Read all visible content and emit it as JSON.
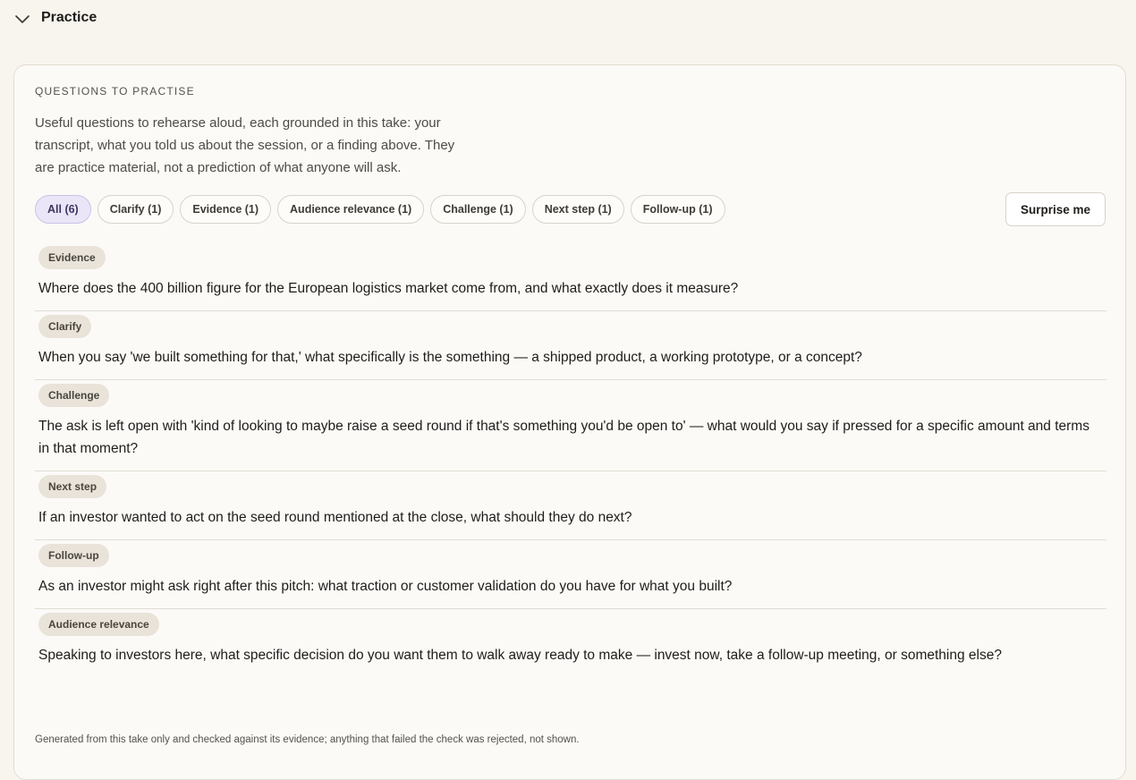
{
  "section": {
    "title": "Practice",
    "icon": "chevron-down-icon"
  },
  "card": {
    "eyebrow": "QUESTIONS TO PRACTISE",
    "intro": "Useful questions to rehearse aloud, each grounded in this take: your transcript, what you told us about the session, or a finding above. They are practice material, not a prediction of what anyone will ask.",
    "surprise_label": "Surprise me",
    "footnote": "Generated from this take only and checked against its evidence; anything that failed the check was rejected, not shown."
  },
  "filters": [
    {
      "label": "All (6)",
      "active": true
    },
    {
      "label": "Clarify (1)",
      "active": false
    },
    {
      "label": "Evidence (1)",
      "active": false
    },
    {
      "label": "Audience relevance (1)",
      "active": false
    },
    {
      "label": "Challenge (1)",
      "active": false
    },
    {
      "label": "Next step (1)",
      "active": false
    },
    {
      "label": "Follow-up (1)",
      "active": false
    }
  ],
  "questions": [
    {
      "tag": "Evidence",
      "text": "Where does the 400 billion figure for the European logistics market come from, and what exactly does it measure?"
    },
    {
      "tag": "Clarify",
      "text": "When you say 'we built something for that,' what specifically is the something — a shipped product, a working prototype, or a concept?"
    },
    {
      "tag": "Challenge",
      "text": "The ask is left open with 'kind of looking to maybe raise a seed round if that's something you'd be open to' — what would you say if pressed for a specific amount and terms in that moment?"
    },
    {
      "tag": "Next step",
      "text": "If an investor wanted to act on the seed round mentioned at the close, what should they do next?"
    },
    {
      "tag": "Follow-up",
      "text": "As an investor might ask right after this pitch: what traction or customer validation do you have for what you built?"
    },
    {
      "tag": "Audience relevance",
      "text": "Speaking to investors here, what specific decision do you want them to walk away ready to make — invest now, take a follow-up meeting, or something else?"
    }
  ],
  "colors": {
    "background": "#f8f5ee",
    "active_chip": "#ebe6f7",
    "tag_bg": "#e9e3d9"
  }
}
